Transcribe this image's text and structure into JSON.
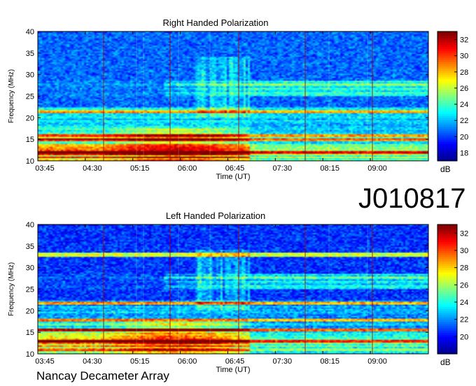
{
  "observation_id": "J010817",
  "instrument": "Nancay Decameter Array",
  "colors": {
    "colormap": [
      "#00008f",
      "#0000ff",
      "#0080ff",
      "#00ffff",
      "#80ff80",
      "#ffff00",
      "#ff8000",
      "#ff0000",
      "#800000"
    ],
    "time_marker": "#b00000",
    "burst_marker": "#ffffc0"
  },
  "chart_data": [
    {
      "type": "heatmap",
      "title": "Right Handed Polarization",
      "xlabel": "Time (UT)",
      "ylabel": "Frequency (MHz)",
      "x_ticks": [
        "03:45",
        "04:30",
        "05:15",
        "06:00",
        "06:45",
        "07:30",
        "08:15",
        "09:00"
      ],
      "y_ticks": [
        10,
        15,
        20,
        25,
        30,
        35,
        40
      ],
      "ylim": [
        10,
        40
      ],
      "xlim": [
        "03:45",
        "09:55"
      ],
      "colorbar": {
        "label": "dB",
        "ticks": [
          18,
          20,
          22,
          24,
          26,
          28,
          30,
          32
        ],
        "range": [
          17,
          33
        ]
      },
      "grid": false
    },
    {
      "type": "heatmap",
      "title": "Left Handed Polarization",
      "xlabel": "Time (UT)",
      "ylabel": "Frequency (MHz)",
      "x_ticks": [
        "03:45",
        "04:30",
        "05:15",
        "06:00",
        "06:45",
        "07:30",
        "08:15",
        "09:00"
      ],
      "y_ticks": [
        10,
        15,
        20,
        25,
        30,
        35,
        40
      ],
      "ylim": [
        10,
        40
      ],
      "xlim": [
        "03:45",
        "09:55"
      ],
      "colorbar": {
        "label": "dB",
        "ticks": [
          20,
          22,
          24,
          26,
          28,
          30,
          32
        ],
        "range": [
          18,
          33
        ]
      },
      "grid": false
    }
  ]
}
